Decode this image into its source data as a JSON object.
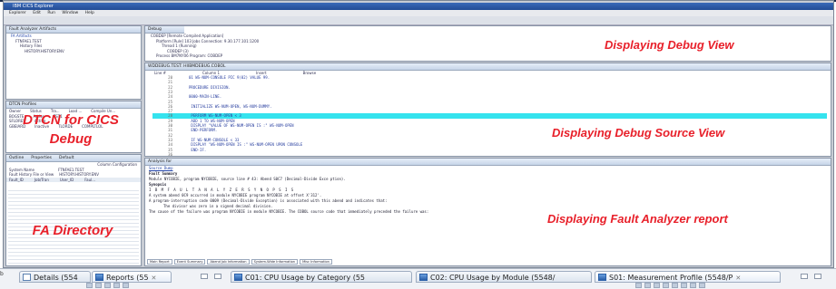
{
  "window": {
    "title": "IBM CICS Explorer",
    "menu": [
      "Explorer",
      "Edit",
      "Run",
      "Window",
      "Help"
    ]
  },
  "left_top_pane": {
    "title": "Fault Analyzer Artifacts",
    "tree": [
      "FA Artifacts",
      "FTNFAE1.TEST",
      "History Files",
      "HISTORY.HISTORY.ENV"
    ]
  },
  "dtcn_pane": {
    "title": "DTCN Profiles",
    "columns": [
      "Owner",
      "Status",
      "Tra...",
      "Load ...",
      "Compile Un..."
    ],
    "rows": [
      [
        "BOGSTE",
        "Active",
        "TST1",
        "",
        ""
      ],
      [
        "SFLORES",
        "Active",
        "",
        "",
        ""
      ],
      [
        "GBEIARD",
        "Inactive",
        "",
        "TLORDE",
        "COMPLTLOL"
      ]
    ]
  },
  "fa_pane": {
    "tabs": [
      "Outline",
      "Properties",
      "Default"
    ],
    "header": "Column Configuration",
    "system_name_label": "System Name",
    "system_name_value": "FTNFAE1.TEST",
    "history_label": "Fault History File or View",
    "history_value": "HISTORY.HISTORY.ENV",
    "columns": [
      "Fault_ID",
      "Job/Tran",
      "User_ID",
      "Faul..."
    ]
  },
  "debug_pane": {
    "title": "Debug",
    "tree": [
      "COBDEP [Remote Compiled Application]",
      "Platform [Rule] 103 Jobs Connection: 9.30.177.101:1200",
      "Thread 1 (Running)",
      "COBDEP (3)",
      "Process BM7NY06 Program: COBDEP"
    ]
  },
  "source_pane": {
    "title": "WDDEBUG.TEST: HIIBMDEBUG.COBOL",
    "columns": [
      "Line #",
      "Column 1",
      "Insert",
      "Browse"
    ],
    "lines": [
      {
        "n": "20",
        "t": "01  WS-NUM-CONSOLE                PIC 9(02) VALUE 99."
      },
      {
        "n": "21",
        "t": ""
      },
      {
        "n": "22",
        "t": "PROCEDURE DIVISION."
      },
      {
        "n": "23",
        "t": ""
      },
      {
        "n": "24",
        "t": "0000-MAIN-LINE."
      },
      {
        "n": "25",
        "t": ""
      },
      {
        "n": "26",
        "t": "    INITIALIZE WS-NUM-OPEN, WS-NUM-DUMMY."
      },
      {
        "n": "27",
        "t": ""
      },
      {
        "n": "28",
        "t": "    PERFORM WS-NUM-OPEN < 3"
      },
      {
        "n": "29",
        "t": "      ADD 1 TO WS-NUM-OPEN"
      },
      {
        "n": "30",
        "t": "      DISPLAY \"VALUE OF WS-NUM-OPEN IS :\" WS-NUM-OPEN"
      },
      {
        "n": "31",
        "t": "    END-PERFORM."
      },
      {
        "n": "32",
        "t": ""
      },
      {
        "n": "33",
        "t": "    IF WS-NUM-CONSOLE < 33"
      },
      {
        "n": "34",
        "t": "      DISPLAY \"WS-NUM-OPEN IS :\" WS-NUM-OPEN UPON CONSOLE"
      },
      {
        "n": "35",
        "t": "    END-IF."
      },
      {
        "n": "36",
        "t": ""
      }
    ],
    "highlight_index": 8
  },
  "report_pane": {
    "title": "Analysis for",
    "link": "Source Dump",
    "section1": "Fault Summary",
    "summary": "Module NYCOBIE, program NYCOBIE, source line # 43: Abend S0C7 (Decimal-Divide Exce ption).",
    "section2": "Synopsis",
    "banner": "I B M   F A U L T   A N A L Y Z E R   S Y N O P S I S",
    "p1": "A system abend 0C9 occurred in module NYCOBIE program NYCOBIE at offset X'312'.",
    "p2": "A program-interruption code 0009 (Decimal-Divide Exception) is associated with this abend and indicates that:",
    "p3": "The divisor was zero in a signed decimal division.",
    "p4": "The cause of the failure was program NYCOBIE in module NYCOBIE. The COBOL source code that immediately preceded the failure was:",
    "bottom_tabs": [
      "Main Report",
      "Event Summary",
      "Abend Job Information",
      "System-Wide Information",
      "Misc Information"
    ]
  },
  "callouts": {
    "dtcn": "DTCN for CICS Debug",
    "fa_directory": "FA Directory",
    "debug_view": "Displaying Debug View",
    "debug_source_view": "Displaying Debug Source View",
    "fa_report": "Displaying Fault Analyzer report"
  },
  "status_tabs": [
    {
      "label": "Details (554",
      "icon": "details-icon"
    },
    {
      "label": "Reports (55",
      "icon": "reports-icon",
      "close": "✕"
    },
    {
      "label": "C01: CPU Usage by Category (55",
      "icon": "report-icon"
    },
    {
      "label": "C02: CPU Usage by Module (5548/",
      "icon": "report-icon"
    },
    {
      "label": "S01: Measurement Profile (5548/P",
      "icon": "report-icon",
      "close": "✕"
    }
  ],
  "left_edge_char": "b"
}
